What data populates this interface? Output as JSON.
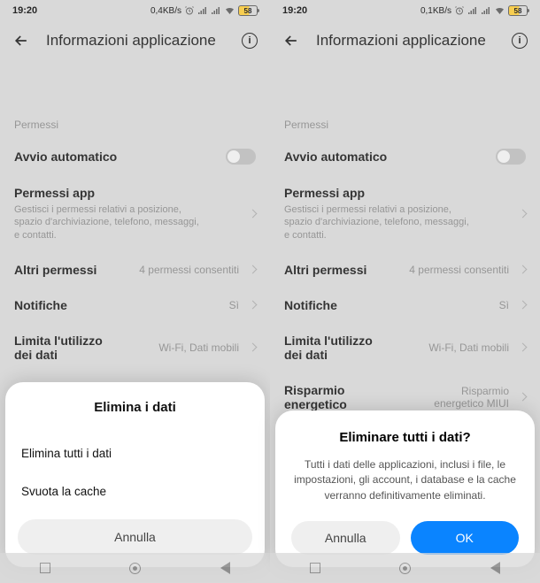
{
  "left": {
    "statusbar": {
      "time": "19:20",
      "net": "0,4KB/s",
      "battery": "58"
    },
    "appbar_title": "Informazioni applicazione",
    "section_label": "Permessi",
    "rows": {
      "autostart": {
        "title": "Avvio automatico"
      },
      "perms": {
        "title": "Permessi app",
        "sub": "Gestisci i permessi relativi a posizione, spazio d'archiviazione, telefono, messaggi, e contatti."
      },
      "other": {
        "title": "Altri permessi",
        "value": "4 permessi consentiti"
      },
      "notif": {
        "title": "Notifiche",
        "value": "Sì"
      },
      "data": {
        "title": "Limita l'utilizzo dei dati",
        "value": "Wi-Fi, Dati mobili"
      }
    },
    "sheet": {
      "title": "Elimina i dati",
      "opt1": "Elimina tutti i dati",
      "opt2": "Svuota la cache",
      "cancel": "Annulla"
    }
  },
  "right": {
    "statusbar": {
      "time": "19:20",
      "net": "0,1KB/s",
      "battery": "58"
    },
    "appbar_title": "Informazioni applicazione",
    "section_label": "Permessi",
    "rows": {
      "autostart": {
        "title": "Avvio automatico"
      },
      "perms": {
        "title": "Permessi app",
        "sub": "Gestisci i permessi relativi a posizione, spazio d'archiviazione, telefono, messaggi, e contatti."
      },
      "other": {
        "title": "Altri permessi",
        "value": "4 permessi consentiti"
      },
      "notif": {
        "title": "Notifiche",
        "value": "Sì"
      },
      "data": {
        "title": "Limita l'utilizzo dei dati",
        "value": "Wi-Fi, Dati mobili"
      },
      "energy": {
        "title": "Risparmio energetico",
        "value": "Risparmio energetico MIUI"
      }
    },
    "dialog": {
      "title": "Eliminare tutti i dati?",
      "body": "Tutti i dati delle applicazioni, inclusi i file, le impostazioni, gli account, i database e la cache verranno definitivamente eliminati.",
      "cancel": "Annulla",
      "ok": "OK"
    }
  }
}
